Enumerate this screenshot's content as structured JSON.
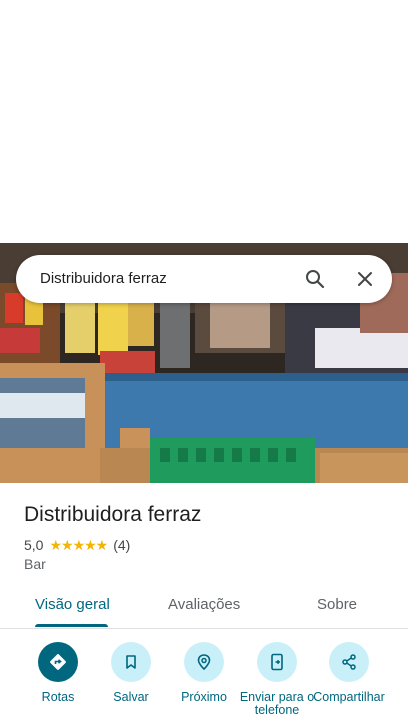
{
  "search": {
    "query": "Distribuidora ferraz"
  },
  "place": {
    "title": "Distribuidora ferraz",
    "rating": "5,0",
    "stars": "★★★★★",
    "reviews": "(4)",
    "category": "Bar"
  },
  "tabs": [
    {
      "label": "Visão geral"
    },
    {
      "label": "Avaliações"
    },
    {
      "label": "Sobre"
    }
  ],
  "actions": [
    {
      "label": "Rotas",
      "icon": "directions-icon"
    },
    {
      "label": "Salvar",
      "icon": "bookmark-icon"
    },
    {
      "label": "Próximo",
      "icon": "nearby-icon"
    },
    {
      "label": "Enviar para o telefone",
      "icon": "send-to-phone-icon"
    },
    {
      "label": "Compartilhar",
      "icon": "share-icon"
    }
  ],
  "colors": {
    "accent": "#00677f",
    "action_bg": "#c9f0f8",
    "star": "#f4b400"
  }
}
